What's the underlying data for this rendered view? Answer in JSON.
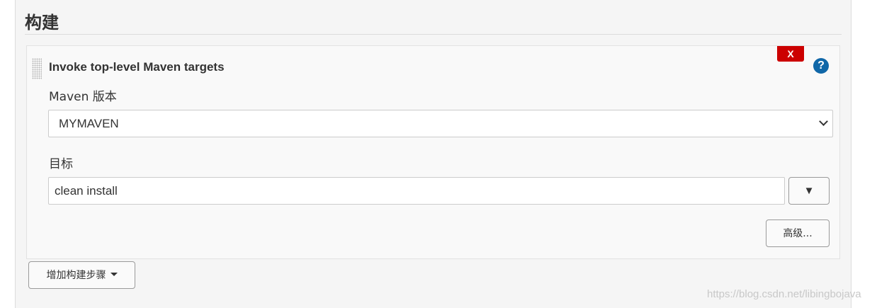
{
  "section": {
    "title": "构建"
  },
  "step": {
    "title": "Invoke top-level Maven targets",
    "delete_label": "X",
    "help_label": "?",
    "maven_version": {
      "label": "Maven 版本",
      "selected": "MYMAVEN"
    },
    "goals": {
      "label": "目标",
      "value": "clean install",
      "expand_label": "▼"
    },
    "advanced_label": "高级..."
  },
  "add_step_label": "增加构建步骤",
  "watermark": "https://blog.csdn.net/libingbojava",
  "colors": {
    "delete_red": "#cc0000",
    "help_blue": "#1067a8",
    "panel_bg": "#f5f5f5"
  },
  "icons": [
    "drag-handle-icon",
    "help-icon",
    "chevron-down-icon",
    "caret-down-icon"
  ]
}
